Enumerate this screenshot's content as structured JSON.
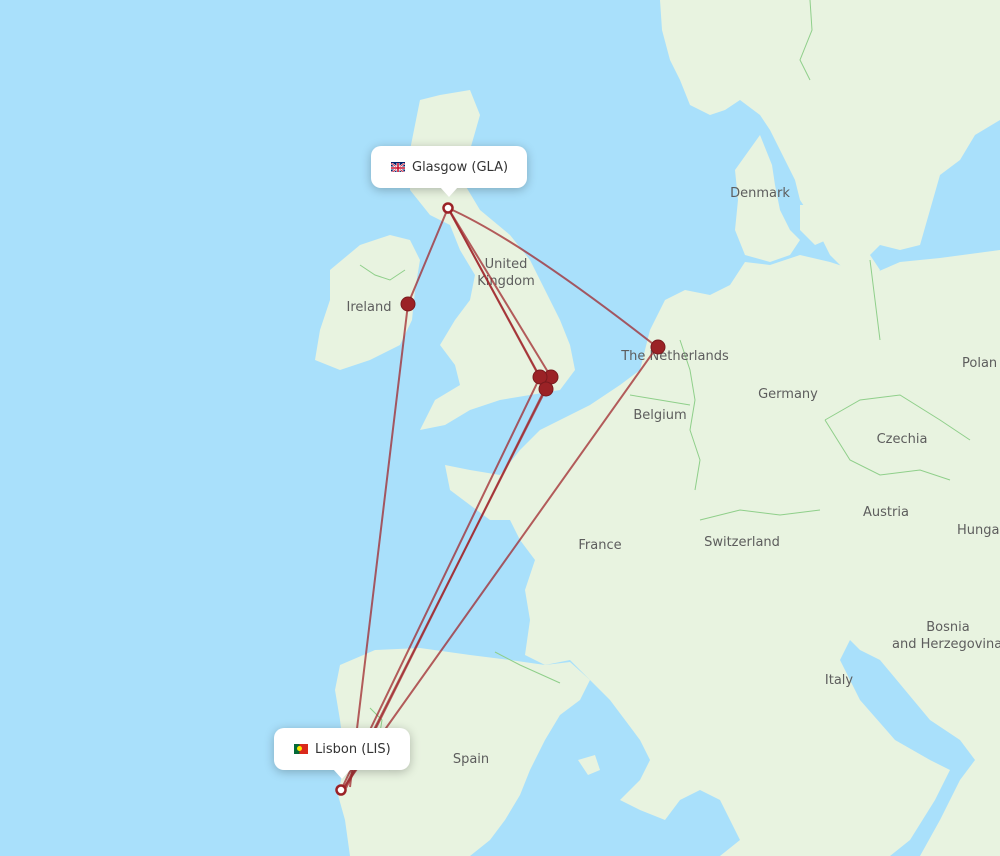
{
  "map": {
    "colors": {
      "water": "#a9e0fb",
      "land": "#e8f3e0",
      "border": "#8fcf8a",
      "route": "#a0282d",
      "marker": "#9b2226"
    },
    "origin": {
      "name": "Glasgow (GLA)",
      "flag": "gb-flag-icon"
    },
    "destination": {
      "name": "Lisbon (LIS)",
      "flag": "pt-flag-icon"
    },
    "country_labels": [
      {
        "id": "denmark",
        "text": "Denmark"
      },
      {
        "id": "united-kingdom-1",
        "text": "United"
      },
      {
        "id": "united-kingdom-2",
        "text": "Kingdom"
      },
      {
        "id": "ireland",
        "text": "Ireland"
      },
      {
        "id": "netherlands",
        "text": "The Netherlands"
      },
      {
        "id": "germany",
        "text": "Germany"
      },
      {
        "id": "poland",
        "text": "Polan"
      },
      {
        "id": "belgium",
        "text": "Belgium"
      },
      {
        "id": "czechia",
        "text": "Czechia"
      },
      {
        "id": "austria",
        "text": "Austria"
      },
      {
        "id": "hungary",
        "text": "Hunga"
      },
      {
        "id": "france",
        "text": "France"
      },
      {
        "id": "switzerland",
        "text": "Switzerland"
      },
      {
        "id": "bosnia-1",
        "text": "Bosnia"
      },
      {
        "id": "bosnia-2",
        "text": "and Herzegovina"
      },
      {
        "id": "italy",
        "text": "Italy"
      },
      {
        "id": "spain",
        "text": "Spain"
      }
    ],
    "stopovers": [
      "Dublin",
      "London (1)",
      "London (2)",
      "London (3)",
      "Amsterdam"
    ]
  }
}
